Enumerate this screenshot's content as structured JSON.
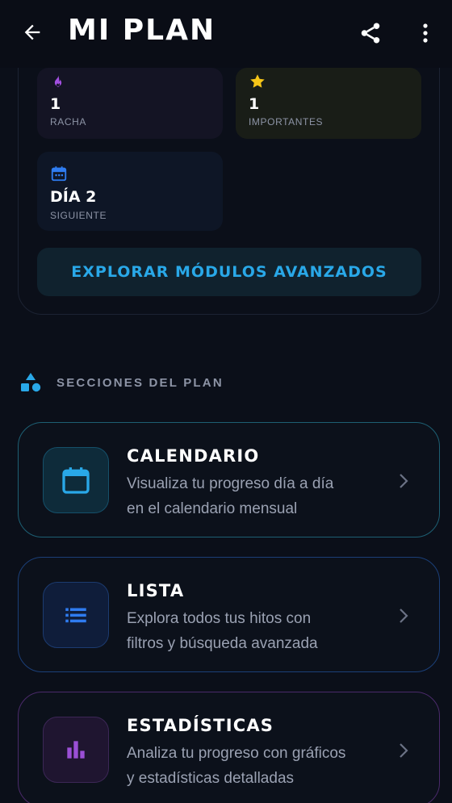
{
  "appbar": {
    "title": "MI PLAN",
    "icons": {
      "back": "arrow-back-icon",
      "share": "share-icon",
      "more": "more-vert-icon"
    }
  },
  "summary": {
    "stats": [
      {
        "icon": "flame-icon",
        "value": "1",
        "label": "RACHA",
        "icon_color": "#a24fe0"
      },
      {
        "icon": "star-icon",
        "value": "1",
        "label": "IMPORTANTES",
        "icon_color": "#f5c518"
      },
      {
        "icon": "calendar-icon",
        "value": "DÍA 2",
        "label": "SIGUIENTE",
        "icon_color": "#2f7cf0"
      }
    ],
    "explore_label": "EXPLORAR MÓDULOS AVANZADOS"
  },
  "sections": {
    "title": "SECCIONES DEL PLAN",
    "icon": "shapes-icon",
    "items": [
      {
        "title": "CALENDARIO",
        "desc_line1": "Visualiza tu progreso día a día",
        "desc_line2": "en el calendario mensual",
        "icon": "calendar-icon",
        "accent": "#29a8e8"
      },
      {
        "title": "LISTA",
        "desc_line1": "Explora todos tus hitos con",
        "desc_line2": "filtros y búsqueda avanzada",
        "icon": "list-icon",
        "accent": "#2f7cf0"
      },
      {
        "title": "ESTADÍSTICAS",
        "desc_line1": "Analiza tu progreso con gráficos",
        "desc_line2": "y estadísticas detalladas",
        "icon": "bar-chart-icon",
        "accent": "#9b4fd6"
      }
    ]
  },
  "colors": {
    "background": "#0b0f19",
    "accent_cyan": "#29a8e8",
    "text_muted": "#8d94a6"
  }
}
